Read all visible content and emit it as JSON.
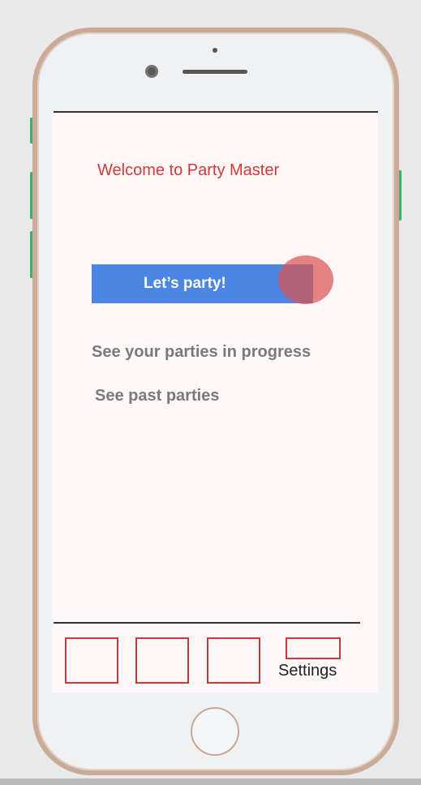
{
  "app": {
    "welcome_title": "Welcome to Party Master",
    "primary_button_label": "Let’s party!",
    "links": {
      "in_progress": "See your parties in progress",
      "past": "See past parties"
    },
    "tabbar": {
      "settings_label": "Settings"
    }
  },
  "colors": {
    "accent_red": "#d23a3a",
    "button_blue": "#4b86e3",
    "side_buttons_green": "#39b36a",
    "phone_frame": "#c9ab97"
  }
}
